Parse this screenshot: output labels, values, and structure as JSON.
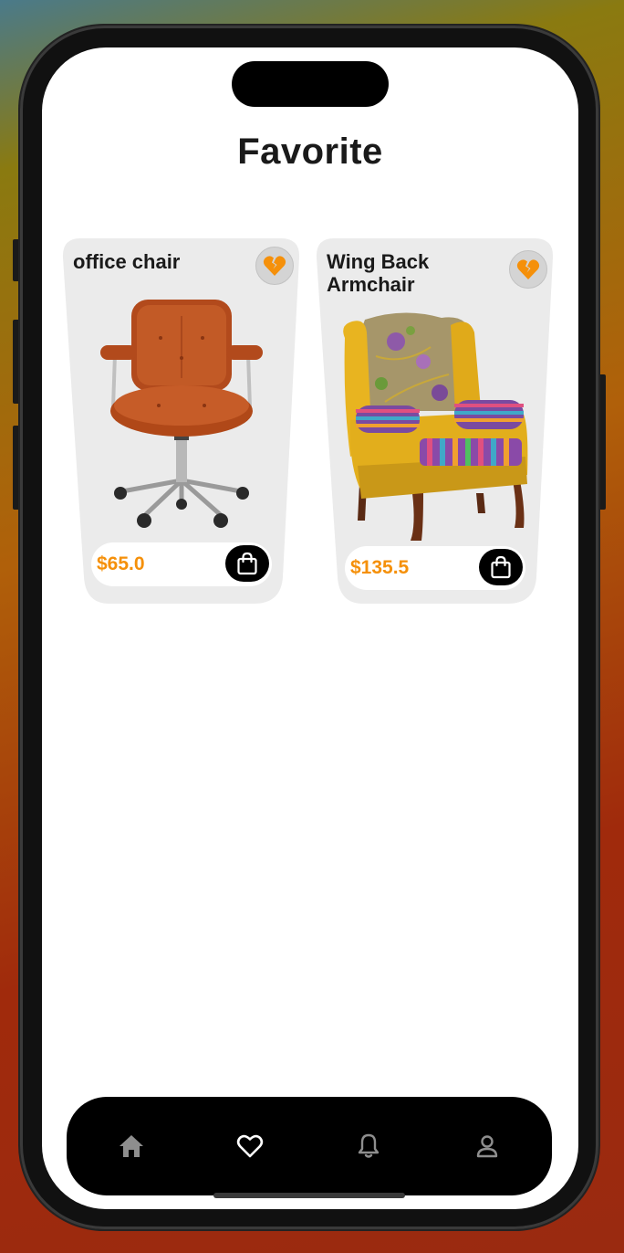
{
  "page": {
    "title": "Favorite"
  },
  "favorites": [
    {
      "name": "office chair",
      "price": "$65.0",
      "image": "orange-office-chair-image"
    },
    {
      "name": "Wing Back Armchair",
      "price": "$135.5",
      "image": "patterned-wingback-armchair-image"
    }
  ],
  "icons": {
    "favorite": "broken-heart-icon",
    "cart": "shopping-bag-icon"
  },
  "tabbar": {
    "items": [
      "home-icon",
      "heart-icon",
      "bell-icon",
      "profile-icon"
    ],
    "active": "heart-icon"
  },
  "colors": {
    "accent": "#f5900a",
    "card_bg": "#ebebeb",
    "tabbar_bg": "#000000",
    "tab_inactive": "#8e8e8e",
    "tab_active": "#ffffff"
  }
}
